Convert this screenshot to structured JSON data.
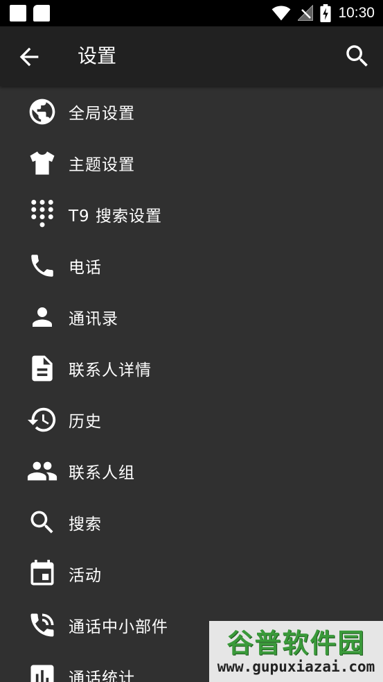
{
  "status_bar": {
    "time": "10:30",
    "icons": [
      "notification-square-icon",
      "notification-square-icon",
      "wifi-icon",
      "no-signal-icon",
      "battery-charging-icon"
    ]
  },
  "app_bar": {
    "title": "设置",
    "back_icon": "arrow-back-icon",
    "search_icon": "search-icon"
  },
  "menu": {
    "items": [
      {
        "label": "全局设置",
        "icon": "globe-icon"
      },
      {
        "label": "主题设置",
        "icon": "tshirt-icon"
      },
      {
        "label": "T9 搜索设置",
        "icon": "dialpad-icon"
      },
      {
        "label": "电话",
        "icon": "phone-icon"
      },
      {
        "label": "通讯录",
        "icon": "person-icon"
      },
      {
        "label": "联系人详情",
        "icon": "document-icon"
      },
      {
        "label": "历史",
        "icon": "history-icon"
      },
      {
        "label": "联系人组",
        "icon": "group-icon"
      },
      {
        "label": "搜索",
        "icon": "search-icon"
      },
      {
        "label": "活动",
        "icon": "calendar-icon"
      },
      {
        "label": "通话中小部件",
        "icon": "phone-in-talk-icon"
      },
      {
        "label": "通话统计",
        "icon": "bar-chart-icon"
      }
    ]
  },
  "watermark": {
    "logo_text": "谷普软件园",
    "url": "www.gupuxiazai.com"
  },
  "colors": {
    "background": "#303030",
    "app_bar": "#212121",
    "status_bar": "#000000",
    "text": "#ffffff"
  }
}
